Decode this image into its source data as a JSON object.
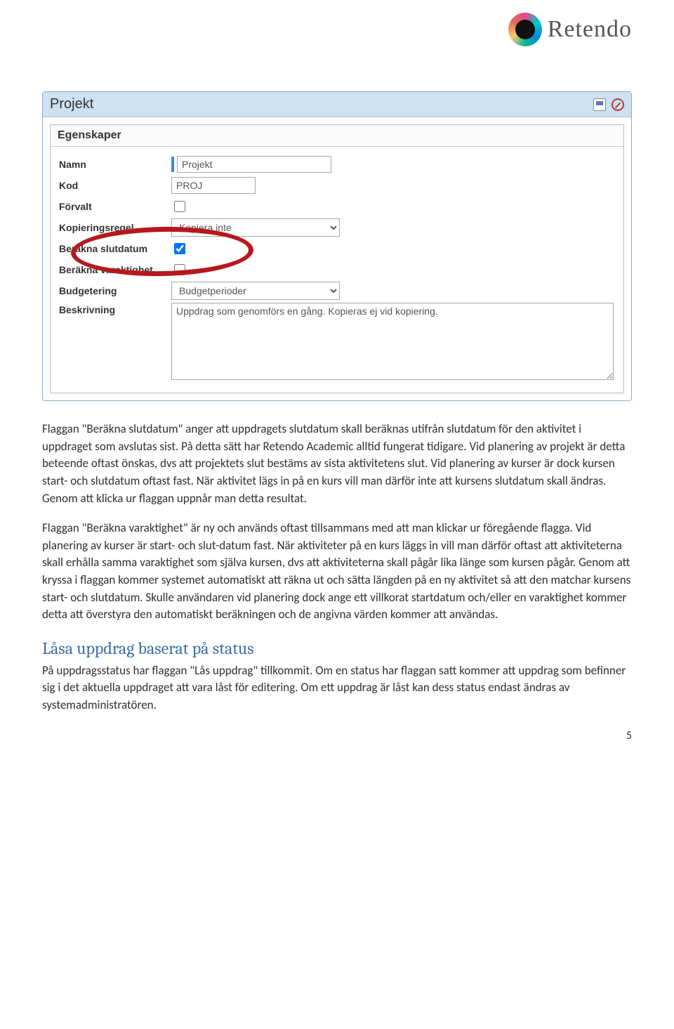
{
  "logo": {
    "brand": "Retendo"
  },
  "form": {
    "window_title": "Projekt",
    "panel_title": "Egenskaper",
    "labels": {
      "namn": "Namn",
      "kod": "Kod",
      "forvalt": "Förvalt",
      "kopieringsregel": "Kopieringsregel",
      "berakna_slutdatum": "Beräkna slutdatum",
      "berakna_varaktighet": "Beräkna varaktighet",
      "budgetering": "Budgetering",
      "beskrivning": "Beskrivning"
    },
    "values": {
      "namn": "Projekt",
      "kod": "PROJ",
      "forvalt_checked": false,
      "kopieringsregel": "Kopiera inte",
      "berakna_slutdatum_checked": true,
      "berakna_varaktighet_checked": false,
      "budgetering": "Budgetperioder",
      "beskrivning": "Uppdrag som genomförs en gång. Kopieras ej vid kopiering."
    }
  },
  "paragraphs": {
    "p1": "Flaggan \"Beräkna slutdatum\" anger att uppdragets slutdatum skall beräknas utifrån slutdatum för den aktivitet i uppdraget som avslutas sist. På detta sätt har Retendo Academic alltid fungerat tidigare. Vid planering av projekt är detta beteende oftast önskas, dvs att projektets slut bestäms av sista aktivitetens slut. Vid planering av kurser är dock kursen start- och slutdatum oftast fast. När aktivitet lägs in på en kurs vill man därför inte att kursens slutdatum skall ändras. Genom att klicka ur flaggan uppnår man detta resultat.",
    "p2": "Flaggan \"Beräkna varaktighet\" är ny och används oftast tillsammans med att man klickar ur föregående flagga. Vid planering av kurser är start- och slut-datum fast. När aktiviteter på en kurs läggs in vill man därför oftast att aktiviteterna skall erhålla samma varaktighet som själva kursen, dvs att aktiviteterna skall pågår lika länge som kursen pågår. Genom att kryssa i flaggan kommer systemet automatiskt att räkna ut och sätta längden på en ny aktivitet så att den matchar kursens start- och slutdatum. Skulle användaren vid planering dock ange ett villkorat startdatum och/eller en varaktighet kommer detta att överstyra den automatiskt beräkningen och de angivna värden kommer att användas.",
    "section_heading": "Låsa uppdrag baserat på status",
    "p3": "På uppdragsstatus har flaggan \"Lås uppdrag\" tillkommit. Om en status har flaggan satt kommer att uppdrag som befinner sig i det aktuella uppdraget att vara låst för editering. Om ett uppdrag är låst kan dess status endast ändras av systemadministratören."
  },
  "page_number": "5"
}
